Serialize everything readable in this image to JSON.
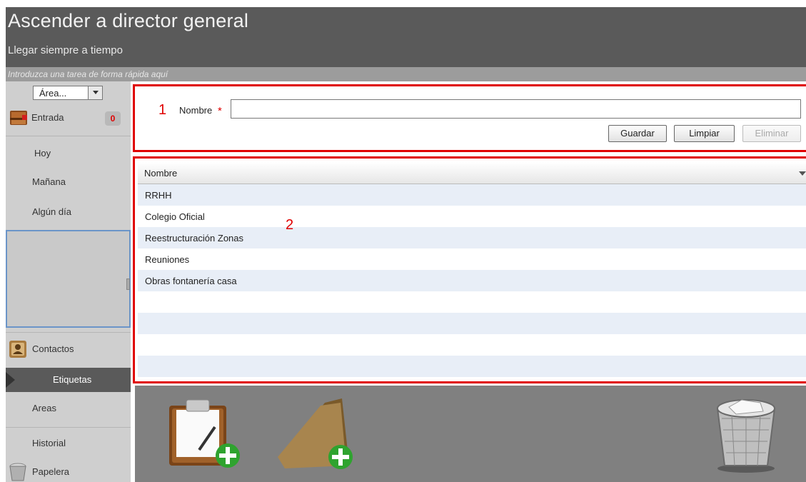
{
  "header": {
    "title": "Ascender a director general",
    "subtitle": "Llegar siempre a tiempo"
  },
  "quick_entry": {
    "placeholder": "Introduzca una tarea de forma rápida aquí"
  },
  "sidebar": {
    "area_select": {
      "value": "Área..."
    },
    "inbox": {
      "label": "Entrada",
      "count": "0"
    },
    "items": [
      {
        "label": "Hoy"
      },
      {
        "label": "Mañana"
      },
      {
        "label": "Algún día"
      }
    ],
    "contacts": {
      "label": "Contactos"
    },
    "tags": {
      "label": "Etiquetas"
    },
    "areas": {
      "label": "Areas"
    },
    "history": {
      "label": "Historial"
    },
    "trash": {
      "label": "Papelera"
    }
  },
  "form": {
    "annotation": "1",
    "name_label": "Nombre",
    "required_marker": "*",
    "name_value": "",
    "buttons": {
      "save": "Guardar",
      "clear": "Limpiar",
      "delete": "Eliminar"
    }
  },
  "grid": {
    "annotation": "2",
    "column_header": "Nombre",
    "rows": [
      "RRHH",
      "Colegio Oficial",
      "Reestructuración Zonas",
      "Reuniones",
      "Obras fontanería casa",
      "",
      "",
      "",
      "",
      ""
    ]
  },
  "colors": {
    "header_bg": "#5a5a5a",
    "annotation_red": "#e00000",
    "sidebar_bg": "#cfcfcf",
    "bottom_bar_bg": "#808080"
  }
}
